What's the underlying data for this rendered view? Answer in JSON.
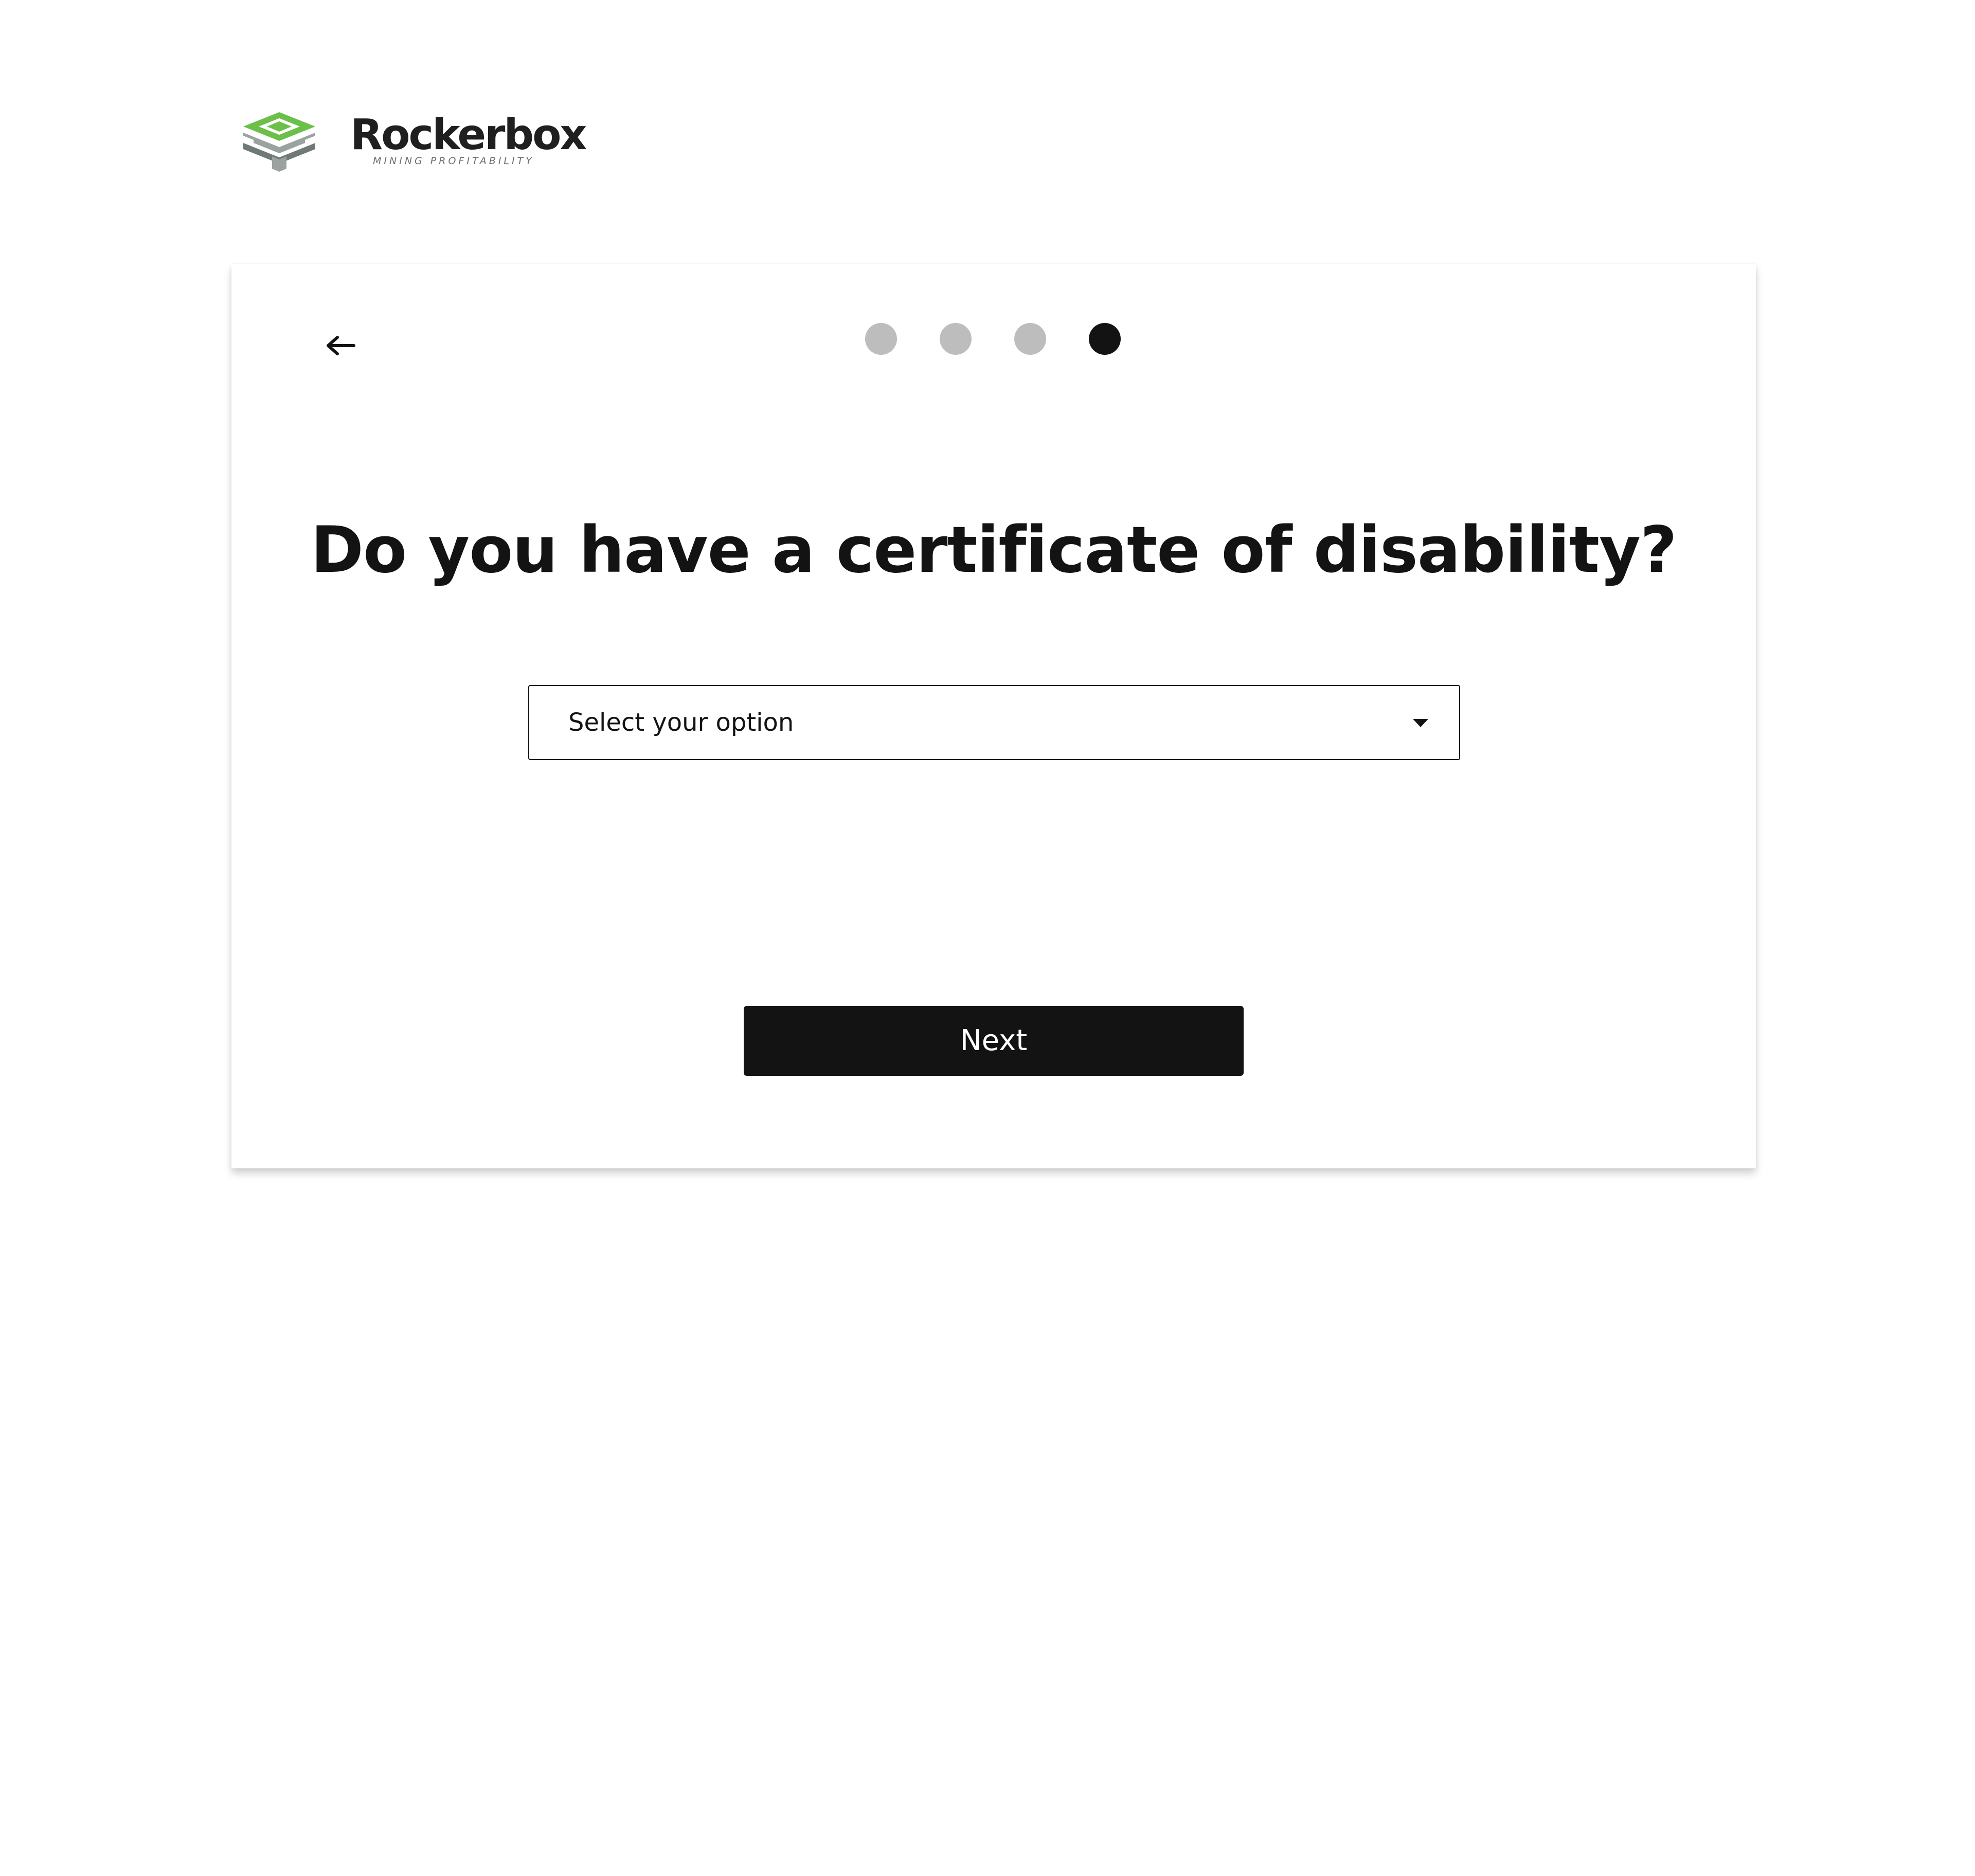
{
  "brand": {
    "name": "Rockerbox",
    "tagline": "MINING PROFITABILITY",
    "colors": {
      "green": "#6cc04a",
      "gray": "#9aa3a0",
      "dark": "#1f1f1f"
    }
  },
  "wizard": {
    "back_icon": "arrow-left-icon",
    "steps": [
      {
        "state": "complete"
      },
      {
        "state": "complete"
      },
      {
        "state": "complete"
      },
      {
        "state": "current"
      }
    ],
    "question": "Do you have a certificate of disability?",
    "select": {
      "placeholder": "Select your option",
      "icon": "caret-down-icon"
    },
    "next_label": "Next"
  },
  "colors": {
    "dot_inactive": "#bdbdbd",
    "dot_active": "#131313",
    "button_bg": "#131313",
    "button_text": "#ffffff"
  }
}
